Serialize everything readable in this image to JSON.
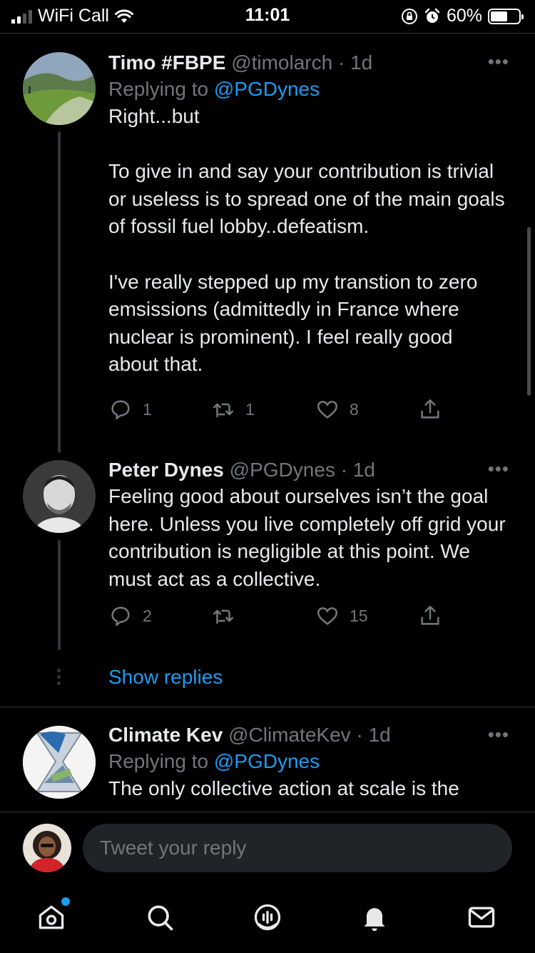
{
  "status_bar": {
    "carrier": "WiFi Call",
    "time": "11:01",
    "battery_percent": "60%",
    "battery_level": 0.6,
    "icons": [
      "cellular-signal-icon",
      "wifi-icon",
      "orientation-lock-icon",
      "alarm-icon",
      "battery-icon"
    ]
  },
  "tweets": [
    {
      "name": "Timo #FBPE",
      "handle": "@timolarch",
      "time": "· 1d",
      "replying_prefix": "Replying to",
      "replying_to": "@PGDynes",
      "text": "Right...but\n\nTo give in and say your contribution is trivial or useless is to spread one of the main goals of fossil fuel lobby..defeatism.\n\nI've really stepped up my transtion to zero emsissions (admittedly in France where nuclear is prominent). I feel really good about that.",
      "replies": "1",
      "retweets": "1",
      "likes": "8"
    },
    {
      "name": "Peter Dynes",
      "handle": "@PGDynes",
      "time": "· 1d",
      "text": "Feeling good about ourselves isn’t the goal here. Unless you live completely off grid your contribution is negligible at this point. We must act as a collective.",
      "replies": "2",
      "retweets": "",
      "likes": "15"
    },
    {
      "name": "Climate Kev",
      "handle": "@ClimateKev",
      "time": "· 1d",
      "replying_prefix": "Replying to",
      "replying_to": "@PGDynes",
      "text": "The only collective action at scale is the"
    }
  ],
  "show_replies": "Show replies",
  "more_glyph": "•••",
  "composer": {
    "placeholder": "Tweet your reply"
  },
  "tab_bar": {
    "tabs": [
      "home-icon",
      "search-icon",
      "spaces-icon",
      "notifications-icon",
      "messages-icon"
    ],
    "accent": "#1d9bf0"
  }
}
